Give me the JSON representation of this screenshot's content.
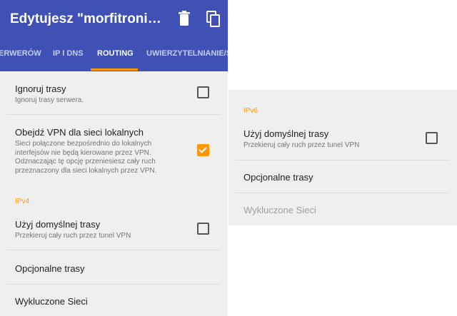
{
  "left": {
    "appbar": {
      "title": "Edytujesz \"morfitronik-cli…",
      "icons": [
        "trash-icon",
        "copy-icon"
      ]
    },
    "tabs": [
      {
        "label": "ERWERÓW",
        "active": false
      },
      {
        "label": "IP I DNS",
        "active": false
      },
      {
        "label": "ROUTING",
        "active": true
      },
      {
        "label": "UWIERZYTELNIANIE/SZ",
        "active": false
      }
    ],
    "prefs": {
      "ignore_routes": {
        "title": "Ignoruj trasy",
        "summary": "Ignoruj trasy serwera.",
        "checked": false
      },
      "bypass_vpn": {
        "title": "Obejdź VPN dla sieci lokalnych",
        "summary_lines": [
          "Sieci połączone bezpośrednio do lokalnych",
          "interfejsów nie będą kierowane przez VPN.",
          "Odznaczając tę opcję przeniesiesz cały ruch",
          "przeznaczony dla sieci lokalnych przez VPN."
        ],
        "checked": true
      },
      "section_ipv4": "IPv4",
      "default_route": {
        "title": "Użyj domyślnej trasy",
        "summary": "Przekieruj cały ruch przez tunel VPN",
        "checked": false
      },
      "optional_routes": {
        "title": "Opcjonalne trasy"
      },
      "excluded_networks": {
        "title": "Wykluczone Sieci"
      }
    }
  },
  "right": {
    "section_ipv6": "IPv6",
    "default_route": {
      "title": "Użyj domyślnej trasy",
      "summary": "Przekieruj cały ruch przez tunel VPN",
      "checked": false
    },
    "optional_routes": {
      "title": "Opcjonalne trasy"
    },
    "excluded_networks": {
      "title": "Wykluczone Sieci",
      "disabled": true
    }
  },
  "colors": {
    "appbar": "#3f51b5",
    "accent": "#ff9800",
    "background": "#efefef"
  }
}
